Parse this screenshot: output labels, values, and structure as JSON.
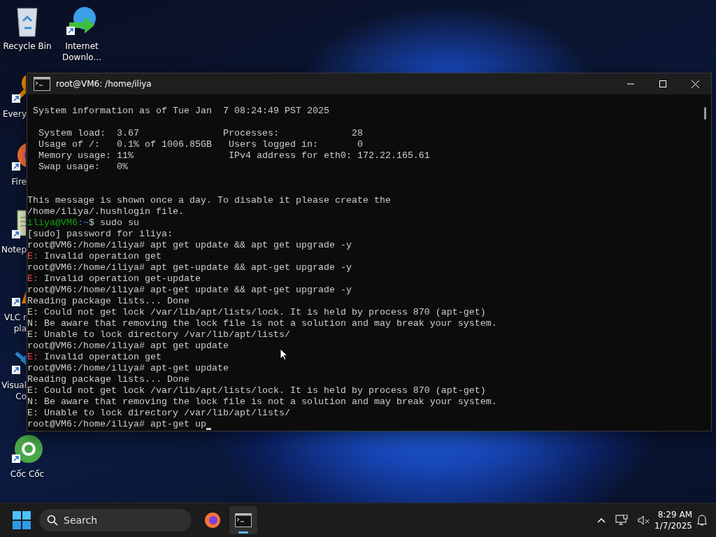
{
  "desktop_icons": [
    {
      "label": [
        "Recycle Bin"
      ],
      "kind": "bin",
      "shortcut": false
    },
    {
      "label": [
        "Internet",
        "Downlo..."
      ],
      "kind": "download",
      "shortcut": true
    },
    {
      "label": [
        "Every"
      ],
      "kind": "search",
      "shortcut": true
    },
    {
      "label": [
        "Fire"
      ],
      "kind": "firefox",
      "shortcut": true
    },
    {
      "label": [
        "Notep"
      ],
      "kind": "notepad",
      "shortcut": true
    },
    {
      "label": [
        "VLC r",
        "pla"
      ],
      "kind": "vlc",
      "shortcut": true
    },
    {
      "label": [
        "Visual",
        "Co"
      ],
      "kind": "vscode",
      "shortcut": true
    },
    {
      "label": [
        "Cốc Cốc"
      ],
      "kind": "coccoc",
      "shortcut": true
    }
  ],
  "window": {
    "title": "root@VM6: /home/iliya",
    "lines": [
      {
        "kind": "plain",
        "text": " System information as of Tue Jan  7 08:24:49 PST 2025"
      },
      {
        "kind": "blank"
      },
      {
        "kind": "plain",
        "text": "  System load:  3.67               Processes:             28"
      },
      {
        "kind": "plain",
        "text": "  Usage of /:   0.1% of 1006.85GB   Users logged in:       0"
      },
      {
        "kind": "plain",
        "text": "  Memory usage: 11%                 IPv4 address for eth0: 172.22.165.61"
      },
      {
        "kind": "plain",
        "text": "  Swap usage:   0%"
      },
      {
        "kind": "blank"
      },
      {
        "kind": "blank"
      },
      {
        "kind": "plain",
        "text": "This message is shown once a day. To disable it please create the"
      },
      {
        "kind": "plain",
        "text": "/home/iliya/.hushlogin file."
      },
      {
        "kind": "user_prompt",
        "user": "iliya@VM6",
        "path": ":~",
        "text": "$ sudo su"
      },
      {
        "kind": "plain",
        "text": "[sudo] password for iliya:"
      },
      {
        "kind": "plain",
        "text": "root@VM6:/home/iliya# apt get update && apt get upgrade -y"
      },
      {
        "kind": "error",
        "prefix": "E:",
        "text": " Invalid operation get"
      },
      {
        "kind": "plain",
        "text": "root@VM6:/home/iliya# apt get-update && apt-get upgrade -y"
      },
      {
        "kind": "error",
        "prefix": "E:",
        "text": " Invalid operation get-update"
      },
      {
        "kind": "plain",
        "text": "root@VM6:/home/iliya# apt-get update && apt-get upgrade -y"
      },
      {
        "kind": "plain",
        "text": "Reading package lists... Done"
      },
      {
        "kind": "plain",
        "text": "E: Could not get lock /var/lib/apt/lists/lock. It is held by process 870 (apt-get)"
      },
      {
        "kind": "plain",
        "text": "N: Be aware that removing the lock file is not a solution and may break your system."
      },
      {
        "kind": "plain",
        "text": "E: Unable to lock directory /var/lib/apt/lists/"
      },
      {
        "kind": "plain",
        "text": "root@VM6:/home/iliya# apt get update"
      },
      {
        "kind": "error",
        "prefix": "E:",
        "text": " Invalid operation get"
      },
      {
        "kind": "plain",
        "text": "root@VM6:/home/iliya# apt-get update"
      },
      {
        "kind": "plain",
        "text": "Reading package lists... Done"
      },
      {
        "kind": "plain",
        "text": "E: Could not get lock /var/lib/apt/lists/lock. It is held by process 870 (apt-get)"
      },
      {
        "kind": "plain",
        "text": "N: Be aware that removing the lock file is not a solution and may break your system."
      },
      {
        "kind": "plain",
        "text": "E: Unable to lock directory /var/lib/apt/lists/"
      },
      {
        "kind": "input",
        "text": "root@VM6:/home/iliya# apt-get up"
      }
    ]
  },
  "taskbar": {
    "search": {
      "placeholder": "Search"
    },
    "apps": [
      {
        "kind": "firefox",
        "selected": false
      },
      {
        "kind": "terminal",
        "selected": true
      }
    ],
    "time": "8:29 AM",
    "date": "1/7/2025"
  }
}
